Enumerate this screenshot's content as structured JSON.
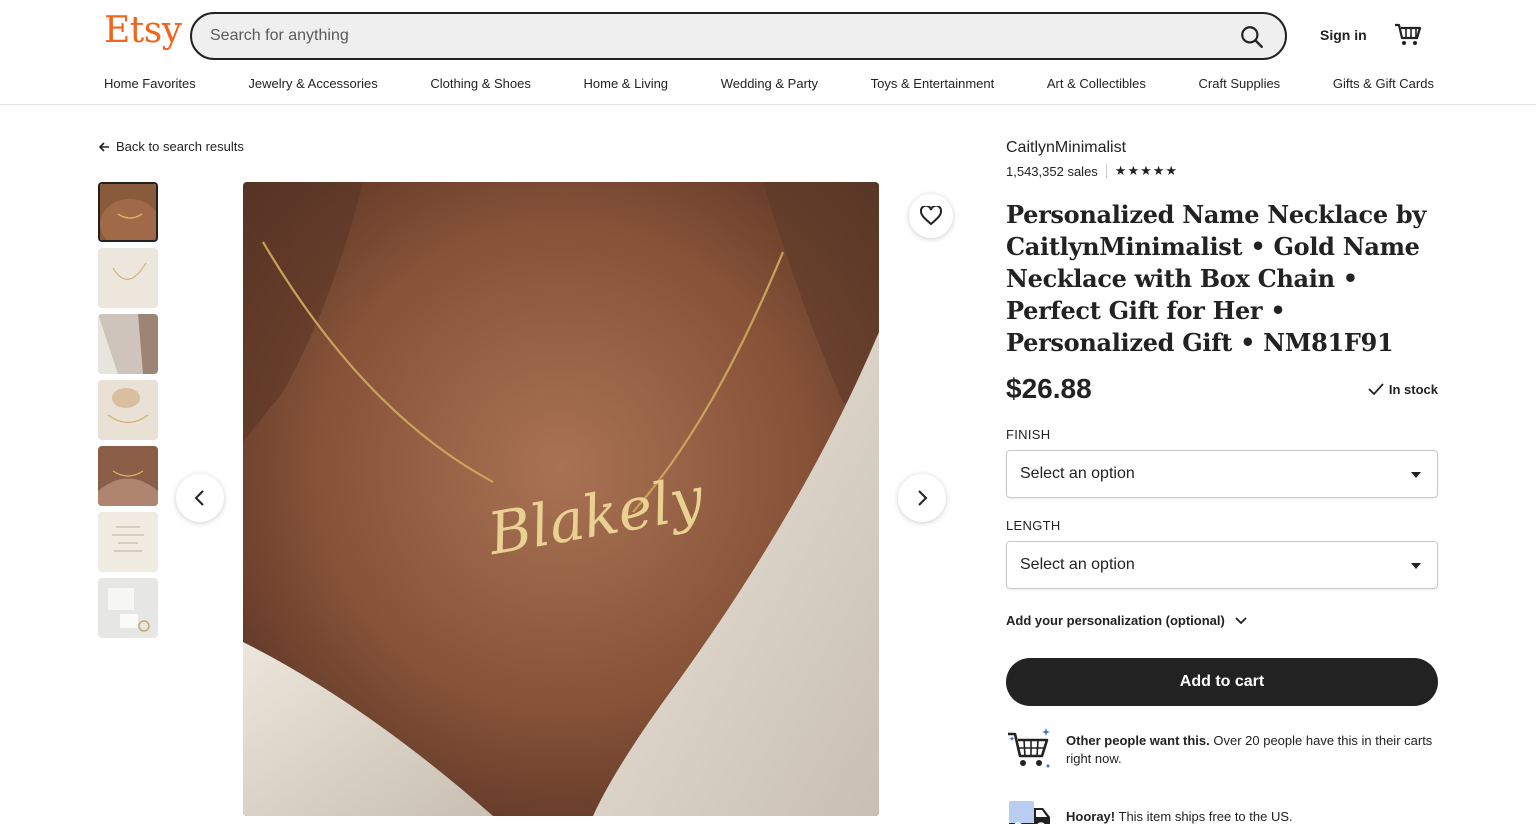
{
  "header": {
    "logo": "Etsy",
    "search_placeholder": "Search for anything",
    "sign_in": "Sign in"
  },
  "categories": [
    "Home Favorites",
    "Jewelry & Accessories",
    "Clothing & Shoes",
    "Home & Living",
    "Wedding & Party",
    "Toys & Entertainment",
    "Art & Collectibles",
    "Craft Supplies",
    "Gifts & Gift Cards"
  ],
  "gallery": {
    "back_link": "Back to search results",
    "thumbnail_count": 7,
    "active_index": 0,
    "image_caption_visible": "Blakely"
  },
  "listing": {
    "shop_name": "CaitlynMinimalist",
    "sales": "1,543,352 sales",
    "rating_stars": 5,
    "title": "Personalized Name Necklace by CaitlynMinimalist • Gold Name Necklace with Box Chain • Perfect Gift for Her • Personalized Gift • NM81F91",
    "price": "$26.88",
    "stock": "In stock",
    "options": [
      {
        "label": "FINISH",
        "value": "Select an option"
      },
      {
        "label": "LENGTH",
        "value": "Select an option"
      }
    ],
    "personalization": "Add your personalization (optional)",
    "add_to_cart": "Add to cart",
    "demand_bold": "Other people want this.",
    "demand_text": " Over 20 people have this in their carts right now.",
    "ship_bold": "Hooray!",
    "ship_text": " This item ships free to the US."
  },
  "colors": {
    "brand": "#f1641e",
    "primary_button": "#222222",
    "search_bg": "#efefef"
  }
}
